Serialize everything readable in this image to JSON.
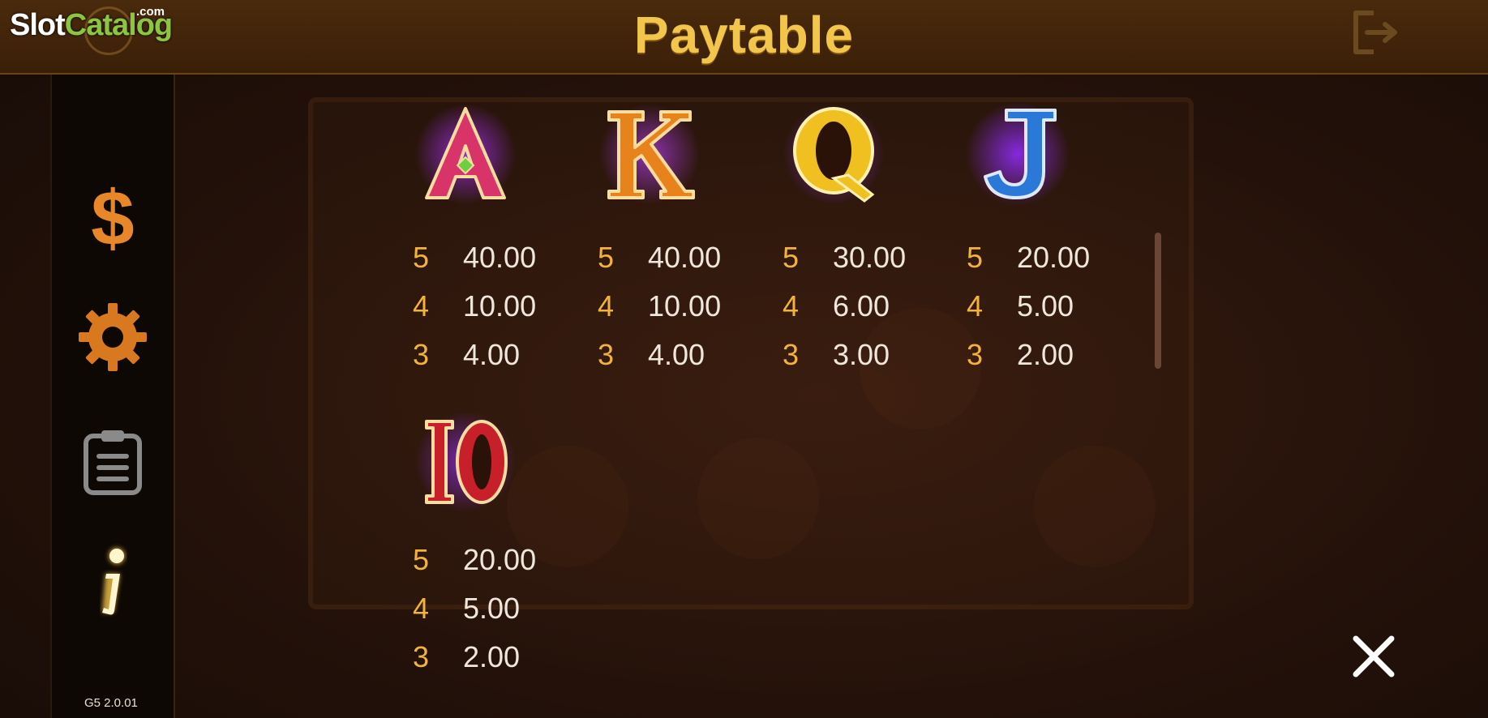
{
  "header": {
    "title": "Paytable"
  },
  "logo": {
    "part1": "Slot",
    "part2": "Catalog",
    "suffix": ".com"
  },
  "sidebar": {
    "items": [
      {
        "name": "bet",
        "icon": "dollar-icon",
        "color": "#e8872a"
      },
      {
        "name": "settings",
        "icon": "gear-icon",
        "color": "#d9791f"
      },
      {
        "name": "history",
        "icon": "clipboard-icon",
        "color": "#8a8a8a"
      },
      {
        "name": "info",
        "icon": "info-icon",
        "color": "#fff3c0"
      }
    ]
  },
  "version": "G5 2.0.01",
  "paytable": [
    {
      "symbol": "A",
      "letter_color": "#d8346a",
      "glow": "#9b2ee0",
      "pays": [
        {
          "count": "5",
          "value": "40.00"
        },
        {
          "count": "4",
          "value": "10.00"
        },
        {
          "count": "3",
          "value": "4.00"
        }
      ]
    },
    {
      "symbol": "K",
      "letter_color": "#e8821a",
      "glow": "#a53ad6",
      "pays": [
        {
          "count": "5",
          "value": "40.00"
        },
        {
          "count": "4",
          "value": "10.00"
        },
        {
          "count": "3",
          "value": "4.00"
        }
      ]
    },
    {
      "symbol": "Q",
      "letter_color": "#f0c020",
      "glow": "#8b30d8",
      "pays": [
        {
          "count": "5",
          "value": "30.00"
        },
        {
          "count": "4",
          "value": "6.00"
        },
        {
          "count": "3",
          "value": "3.00"
        }
      ]
    },
    {
      "symbol": "J",
      "letter_color": "#2a78d8",
      "glow": "#8a2ae8",
      "pays": [
        {
          "count": "5",
          "value": "20.00"
        },
        {
          "count": "4",
          "value": "5.00"
        },
        {
          "count": "3",
          "value": "2.00"
        }
      ]
    },
    {
      "symbol": "10",
      "letter_color": "#c8202a",
      "glow": "#8a2ad8",
      "pays": [
        {
          "count": "5",
          "value": "20.00"
        },
        {
          "count": "4",
          "value": "5.00"
        },
        {
          "count": "3",
          "value": "2.00"
        }
      ]
    }
  ],
  "colors": {
    "title": "#f2c64a",
    "count": "#f2b33a",
    "value": "#efe6dc",
    "header_bg": "#4a2a0c"
  }
}
